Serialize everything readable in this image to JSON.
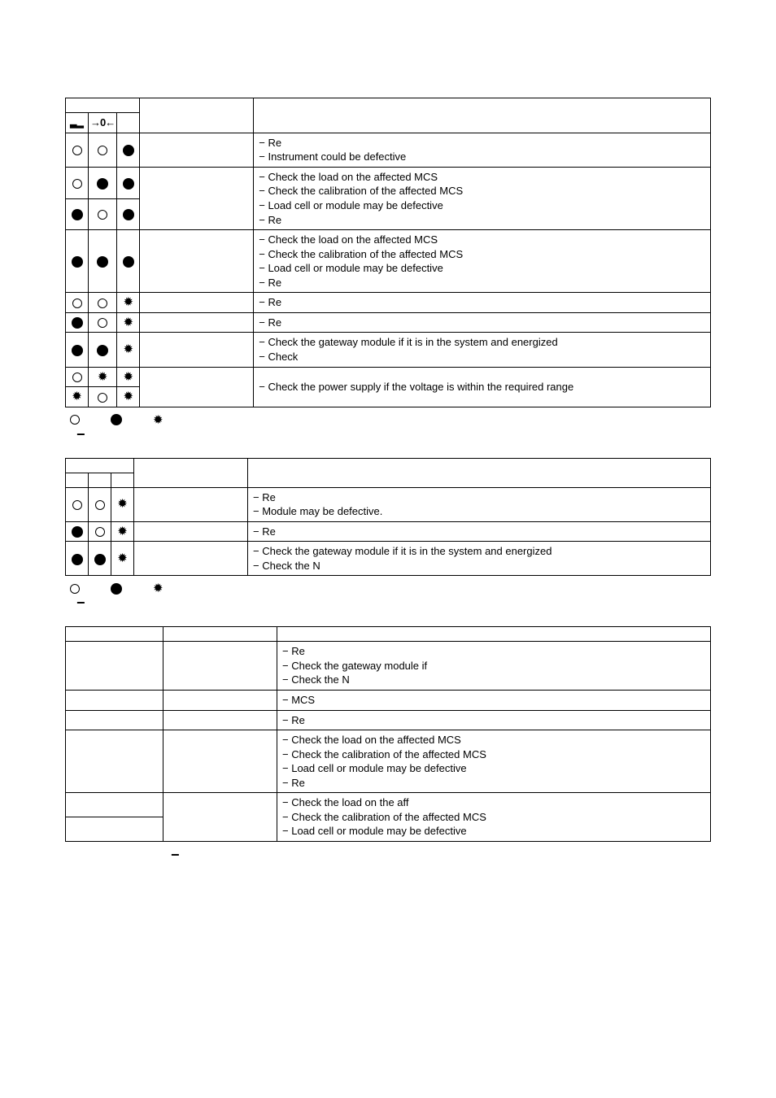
{
  "table1": {
    "rows": [
      {
        "i1": "open",
        "i2": "open",
        "i3": "fill",
        "desc": "",
        "actions": [
          "Re",
          "Instrument could be defective"
        ]
      },
      {
        "i1": "open",
        "i2": "fill",
        "i3": "fill",
        "desc": "",
        "actions": [
          "Check the load on the affected MCS",
          "Check the calibration of the affected MCS"
        ],
        "merge_down": true
      },
      {
        "i1": "fill",
        "i2": "open",
        "i3": "fill",
        "desc": "",
        "actions": [
          "Load cell or module may be defective",
          "Re"
        ],
        "merged": true
      },
      {
        "i1": "fill",
        "i2": "fill",
        "i3": "fill",
        "desc": "",
        "actions": [
          "Check the load on the affected MCS",
          "Check the calibration of the affected MCS",
          "Load cell or module may be defective",
          "Re"
        ]
      },
      {
        "i1": "open",
        "i2": "open",
        "i3": "gear",
        "desc": "",
        "actions": [
          "Re"
        ]
      },
      {
        "i1": "fill",
        "i2": "open",
        "i3": "gear",
        "desc": "",
        "actions": [
          "Re"
        ]
      },
      {
        "i1": "fill",
        "i2": "fill",
        "i3": "gear",
        "desc": "",
        "actions": [
          "Check the gateway module if it is in the system and energized",
          "Check"
        ]
      },
      {
        "i1": "open",
        "i2": "gear",
        "i3": "gear",
        "desc": "",
        "actions": [
          "Check the power supply if the voltage is within the required range"
        ],
        "merge_down": true
      },
      {
        "i1": "gear",
        "i2": "open",
        "i3": "gear",
        "desc": "",
        "merged": true
      }
    ]
  },
  "table2": {
    "rows": [
      {
        "i1": "open",
        "i2": "open",
        "i3": "gear",
        "desc": "",
        "actions": [
          "Re",
          "Module may be defective."
        ]
      },
      {
        "i1": "fill",
        "i2": "open",
        "i3": "gear",
        "desc": "",
        "actions": [
          "Re"
        ]
      },
      {
        "i1": "fill",
        "i2": "fill",
        "i3": "gear",
        "desc": "",
        "actions": [
          "Check the gateway module if it is in the system and energized",
          "Check the N"
        ]
      }
    ]
  },
  "table3": {
    "rows": [
      {
        "c1": "",
        "c2": "",
        "actions": [
          "Re",
          "Check the gateway module if",
          "Check the N"
        ]
      },
      {
        "c1": "",
        "c2": "",
        "actions": [
          "MCS"
        ]
      },
      {
        "c1": "",
        "c2": "",
        "actions": [
          "Re"
        ]
      },
      {
        "c1": "",
        "c2": "",
        "actions": [
          "Check the load on the affected MCS",
          "Check the calibration of the affected MCS",
          "Load cell or module may be defective",
          "Re"
        ]
      },
      {
        "c1": "",
        "c2": "",
        "actions": [
          "Check the load on the aff"
        ],
        "merge_down": true
      },
      {
        "c1": "",
        "c2": "",
        "actions": [
          "Check the calibration of the affected MCS",
          "Load cell or module may be defective"
        ],
        "merged": true
      }
    ]
  },
  "symbols": {
    "arrowheader": "→0←",
    "dash": "−"
  }
}
